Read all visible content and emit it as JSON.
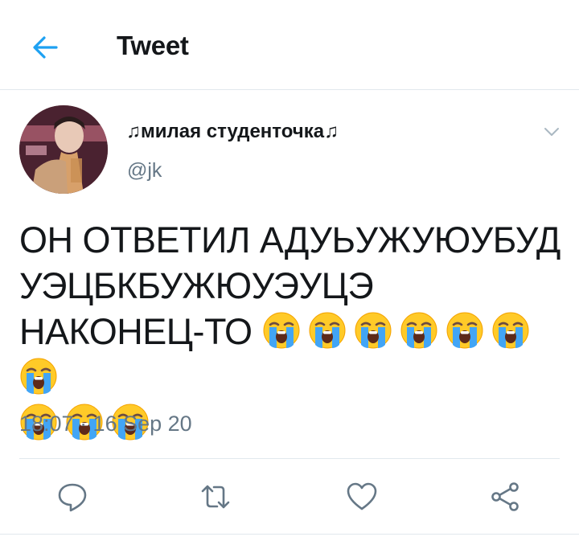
{
  "header": {
    "title": "Tweet",
    "back_icon": "arrow-left-icon",
    "accent_color": "#1da1f2"
  },
  "tweet": {
    "author_name": "♫милая студенточка♫",
    "author_handle": "@jk",
    "text_lines": [
      "ОН ОТВЕТИЛ АДУЬУЖУЮУБУД",
      "УЭЦБКБУЖЮУЭУЦЭ",
      "НАКОНЕЦ-ТО"
    ],
    "emoji": "loudly-crying-face",
    "emoji_count": 10,
    "timestamp": "18:07 · 16 Sep 20"
  },
  "actions": {
    "reply_icon": "reply-icon",
    "retweet_icon": "retweet-icon",
    "like_icon": "heart-icon",
    "share_icon": "share-icon"
  }
}
